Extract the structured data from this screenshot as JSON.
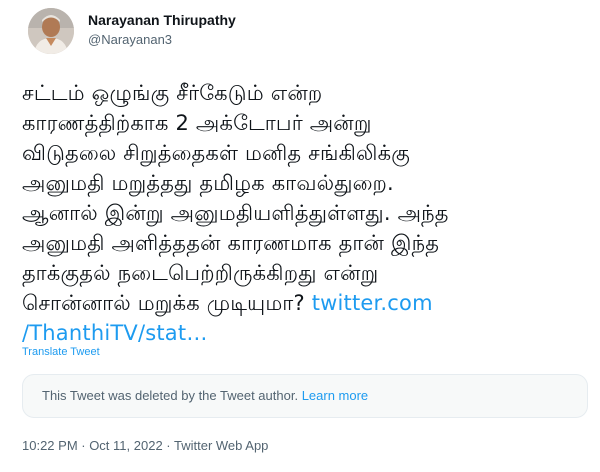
{
  "author": {
    "name": "Narayanan Thirupathy",
    "handle": "@Narayanan3"
  },
  "tweet": {
    "lines": [
      "சட்டம் ஒழுங்கு சீர்கேடும் என்ற",
      "காரணத்திற்காக 2 அக்டோபர் அன்று",
      "விடுதலை சிறுத்தைகள் மனித சங்கிலிக்கு",
      "அனுமதி மறுத்தது தமிழக காவல்துறை.",
      "ஆனால் இன்று அனுமதியளித்துள்ளது. அந்த",
      "அனுமதி அளித்ததன் காரணமாக தான் இந்த",
      "தாக்குதல் நடைபெற்றிருக்கிறது என்று"
    ],
    "last_line_text": "சொன்னால் மறுக்க முடியுமா? ",
    "link_part1": "twitter.com",
    "link_part2": "/ThanthiTV/stat…",
    "translate_label": "Translate Tweet"
  },
  "deleted_notice": {
    "text": "This Tweet was deleted by the Tweet author. ",
    "learn_more": "Learn more"
  },
  "meta": {
    "timestamp": "10:22 PM · Oct 11, 2022 · Twitter Web App"
  },
  "colors": {
    "link": "#1d9bf0",
    "secondary_text": "#536471",
    "primary_text": "#0f1419"
  }
}
